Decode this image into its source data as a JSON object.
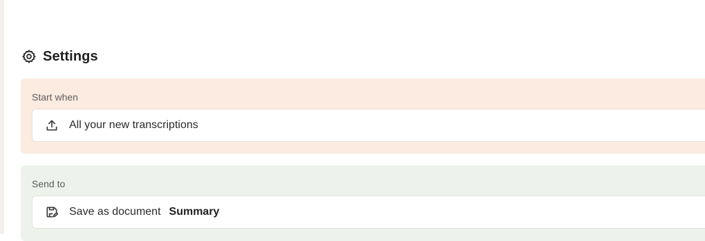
{
  "settings": {
    "title": "Settings",
    "icon": "gear-icon"
  },
  "start_when": {
    "label": "Start when",
    "icon": "upload-icon",
    "value": "All your new transcriptions",
    "background": "#fcebe0"
  },
  "send_to": {
    "label": "Send to",
    "icon": "save-document-icon",
    "action": "Save as document",
    "target": "Summary",
    "background": "#edf3ec"
  }
}
